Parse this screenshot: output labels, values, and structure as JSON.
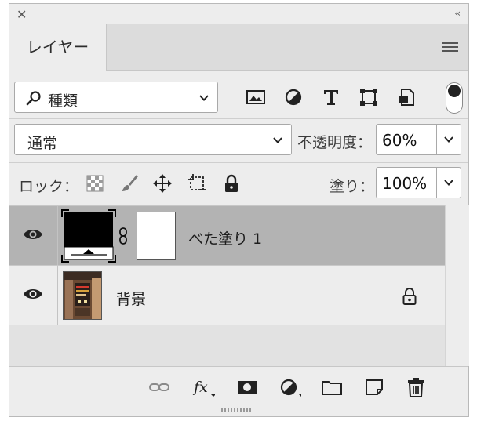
{
  "panel": {
    "tab_label": "レイヤー"
  },
  "filter": {
    "kind_label": "種類",
    "icons": [
      "image-filter-icon",
      "adjustment-filter-icon",
      "type-filter-icon",
      "shape-filter-icon",
      "smart-object-filter-icon"
    ]
  },
  "blend": {
    "mode": "通常",
    "opacity_label": "不透明度：",
    "opacity_value": "60%"
  },
  "lock": {
    "label": "ロック：",
    "fill_label": "塗り：",
    "fill_value": "100%"
  },
  "layers": [
    {
      "name": "べた塗り 1",
      "visible": true,
      "selected": true
    },
    {
      "name": "背景",
      "visible": true,
      "selected": false,
      "locked": true
    }
  ],
  "colors": {
    "panel_bg": "#ededed",
    "selected_row": "#b3b3b3"
  }
}
